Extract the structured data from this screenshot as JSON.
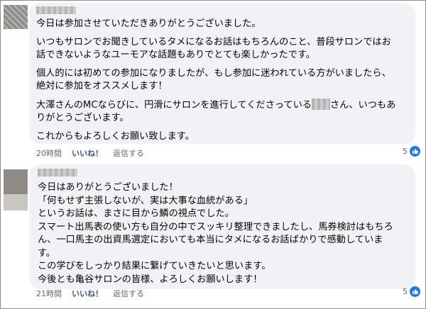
{
  "comments": [
    {
      "paragraphs": [
        [
          "今日は参加させていただきありがとうございました。"
        ],
        [
          "いつもサロンでお聞きしているタメになるお話はもちろんのこと、普段サロンではお",
          "話できないようなユーモアな話題もありでとても楽しかったです。"
        ],
        [
          "個人的には初めての参加になりましたが、もし参加に迷われている方がいましたら、",
          "絶対に参加をオススメします！"
        ],
        [
          "大澤さんのMCならびに、円滑にサロンを進行してくださっている",
          "さん、いつもあ",
          "りがとうございます。"
        ],
        [
          "これからもよろしくお願い致します。"
        ]
      ],
      "time": "20時間",
      "like_label": "いいね！",
      "reply_label": "返信する",
      "reaction_count": "5"
    },
    {
      "lines": [
        "今日はありがとうございました！",
        "「何もせず主張しないが、実は大事な血統がある」",
        "というお話は、まさに目から鱗の視点でした。",
        "スマート出馬表の使い方も自分の中でスッキリ整理できましたし、馬券検討はもちろ",
        "ん、一口馬主の出資馬選定においても本当にタメになるお話ばかりで感動していま",
        "す。",
        "この学びをしっかり結果に繋げていきたいと思います。",
        "今後とも亀谷サロンの皆様、よろしくお願いします！"
      ],
      "time": "21時間",
      "like_label": "いいね！",
      "reply_label": "返信する",
      "reaction_count": "5"
    }
  ],
  "icons": {
    "avatar": "avatar-icon",
    "reaction": "thumbs-up-icon",
    "reaction_color": "#1877f2"
  }
}
